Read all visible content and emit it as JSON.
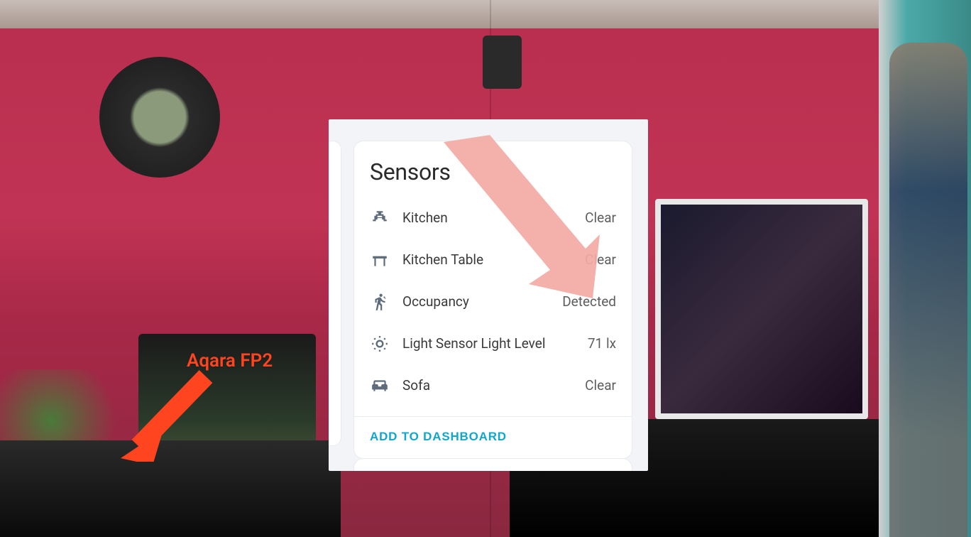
{
  "annotation": {
    "device_label": "Aqara FP2"
  },
  "card": {
    "title": "Sensors",
    "action": "ADD TO DASHBOARD",
    "rows": [
      {
        "icon": "faucet-icon",
        "label": "Kitchen",
        "value": "Clear"
      },
      {
        "icon": "table-icon",
        "label": "Kitchen Table",
        "value": "Clear"
      },
      {
        "icon": "motion-icon",
        "label": "Occupancy",
        "value": "Detected"
      },
      {
        "icon": "brightness-icon",
        "label": "Light Sensor Light Level",
        "value": "71 lx"
      },
      {
        "icon": "sofa-icon",
        "label": "Sofa",
        "value": "Clear"
      }
    ]
  }
}
